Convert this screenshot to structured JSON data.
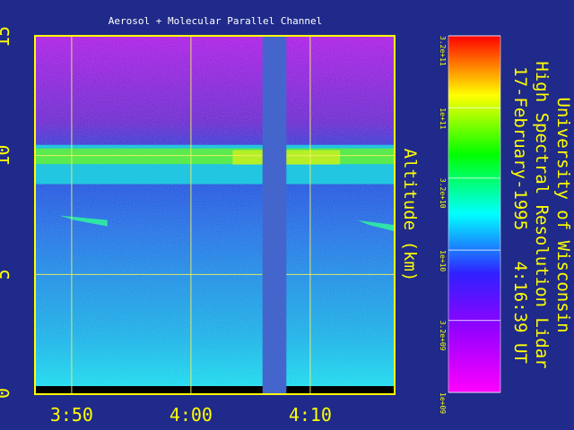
{
  "chart_data": {
    "type": "heatmap",
    "title": "Aerosol + Molecular Parallel Channel",
    "ylabel": "Altitude (km)",
    "ylim": [
      0,
      15
    ],
    "xlim": [
      "3:47",
      "4:17"
    ],
    "x_ticks": [
      "3:50",
      "4:00",
      "4:10"
    ],
    "y_ticks": [
      "0",
      "5",
      "10",
      "15"
    ],
    "grid": true,
    "data_gap": {
      "start": "4:06",
      "end": "4:08"
    },
    "layers": [
      {
        "type": "cirrus",
        "base_km": 9.1,
        "top_km": 10.3,
        "start": "3:47",
        "end": "4:17"
      },
      {
        "type": "thin-layer",
        "altitude_km": 7.4,
        "start": "3:49",
        "end": "3:53"
      },
      {
        "type": "thin-layer",
        "altitude_km": 7.2,
        "start": "4:14",
        "end": "4:17"
      }
    ],
    "colorbar": {
      "scale": "log",
      "range": [
        "1e+09",
        "3.2e+11"
      ],
      "tick_labels": [
        "3.2e+11",
        "1e+11",
        "3.2e+10",
        "1e+10",
        "3.2e+09",
        "1e+09"
      ],
      "colors": [
        "#ff00ff",
        "#9a00ff",
        "#3020ff",
        "#00ffff",
        "#00ff00",
        "#ffff00",
        "#ff0000"
      ]
    }
  },
  "side_text": {
    "line1": "University of Wisconsin",
    "line2": "High Spectral Resolution Lidar",
    "line3": "17-February-1995   4:16:39 UT"
  },
  "colors": {
    "background": "#1f2a8a",
    "frame": "#ffff00",
    "grid": "#f0f060",
    "axis_text": "#ffff00",
    "side_text": "#ffff00",
    "title_text": "#ffffff",
    "gap": "#4466cc"
  }
}
